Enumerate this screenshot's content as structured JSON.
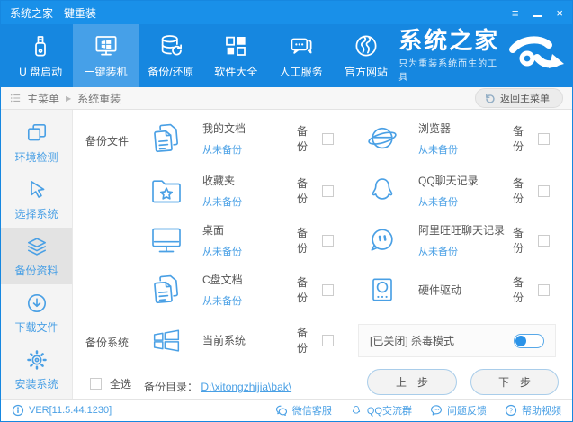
{
  "window": {
    "title": "系统之家一键重装"
  },
  "nav": {
    "items": [
      {
        "label": "U 盘启动",
        "icon": "usb-drive-icon"
      },
      {
        "label": "一键装机",
        "icon": "pc-install-icon"
      },
      {
        "label": "备份/还原",
        "icon": "backup-restore-icon"
      },
      {
        "label": "软件大全",
        "icon": "software-icon"
      },
      {
        "label": "人工服务",
        "icon": "support-icon"
      },
      {
        "label": "官方网站",
        "icon": "website-icon"
      }
    ],
    "active_item": "一键装机",
    "brand_name": "系统之家",
    "brand_tagline": "只为重装系统而生的工具"
  },
  "breadcrumb": {
    "root": "主菜单",
    "current": "系统重装",
    "return_button": "返回主菜单"
  },
  "sidebar": {
    "items": [
      {
        "label": "环境检测",
        "icon": "env-check-icon",
        "active": false
      },
      {
        "label": "选择系统",
        "icon": "select-system-icon",
        "active": false
      },
      {
        "label": "备份资料",
        "icon": "backup-data-icon",
        "active": true
      },
      {
        "label": "下载文件",
        "icon": "download-file-icon",
        "active": false
      },
      {
        "label": "安装系统",
        "icon": "install-system-icon",
        "active": false
      }
    ],
    "active_item": "备份资料"
  },
  "content": {
    "backup_files_label": "备份文件",
    "backup_system_label": "备份系统",
    "backup_checkbox_label": "备份",
    "items_left": [
      {
        "name": "我的文档",
        "status": "从未备份",
        "icon": "my-documents-icon",
        "backup_checked": false
      },
      {
        "name": "收藏夹",
        "status": "从未备份",
        "icon": "favorites-folder-icon",
        "backup_checked": false
      },
      {
        "name": "桌面",
        "status": "从未备份",
        "icon": "desktop-icon",
        "backup_checked": false
      },
      {
        "name": "C盘文档",
        "status": "从未备份",
        "icon": "c-drive-docs-icon",
        "backup_checked": false
      }
    ],
    "items_right": [
      {
        "name": "浏览器",
        "status": "从未备份",
        "icon": "browser-icon",
        "backup_checked": false
      },
      {
        "name": "QQ聊天记录",
        "status": "从未备份",
        "icon": "qq-icon",
        "backup_checked": false
      },
      {
        "name": "阿里旺旺聊天记录",
        "status": "从未备份",
        "icon": "wangwang-icon",
        "backup_checked": false
      },
      {
        "name": "硬件驱动",
        "status": "",
        "icon": "hardware-driver-icon",
        "backup_checked": false
      }
    ],
    "system_item": {
      "name": "当前系统",
      "icon": "windows-icon",
      "backup_checked": false
    },
    "antivirus": {
      "label": "[已关闭] 杀毒模式",
      "enabled": false
    },
    "select_all_label": "全选",
    "select_all_checked": false,
    "backup_dir_label": "备份目录：",
    "backup_dir_path": "D:\\xitongzhijia\\bak\\",
    "prev_button": "上一步",
    "next_button": "下一步"
  },
  "statusbar": {
    "version": "VER[11.5.44.1230]",
    "links": [
      {
        "label": "微信客服",
        "icon": "wechat-icon"
      },
      {
        "label": "QQ交流群",
        "icon": "qq-group-icon"
      },
      {
        "label": "问题反馈",
        "icon": "feedback-icon"
      },
      {
        "label": "帮助视频",
        "icon": "help-video-icon"
      }
    ]
  },
  "colors": {
    "accent": "#1687e0",
    "nav_active": "#46a0e8",
    "link": "#4aa0e5",
    "text": "#555555",
    "sidebar_active": "#e3e3e3"
  }
}
